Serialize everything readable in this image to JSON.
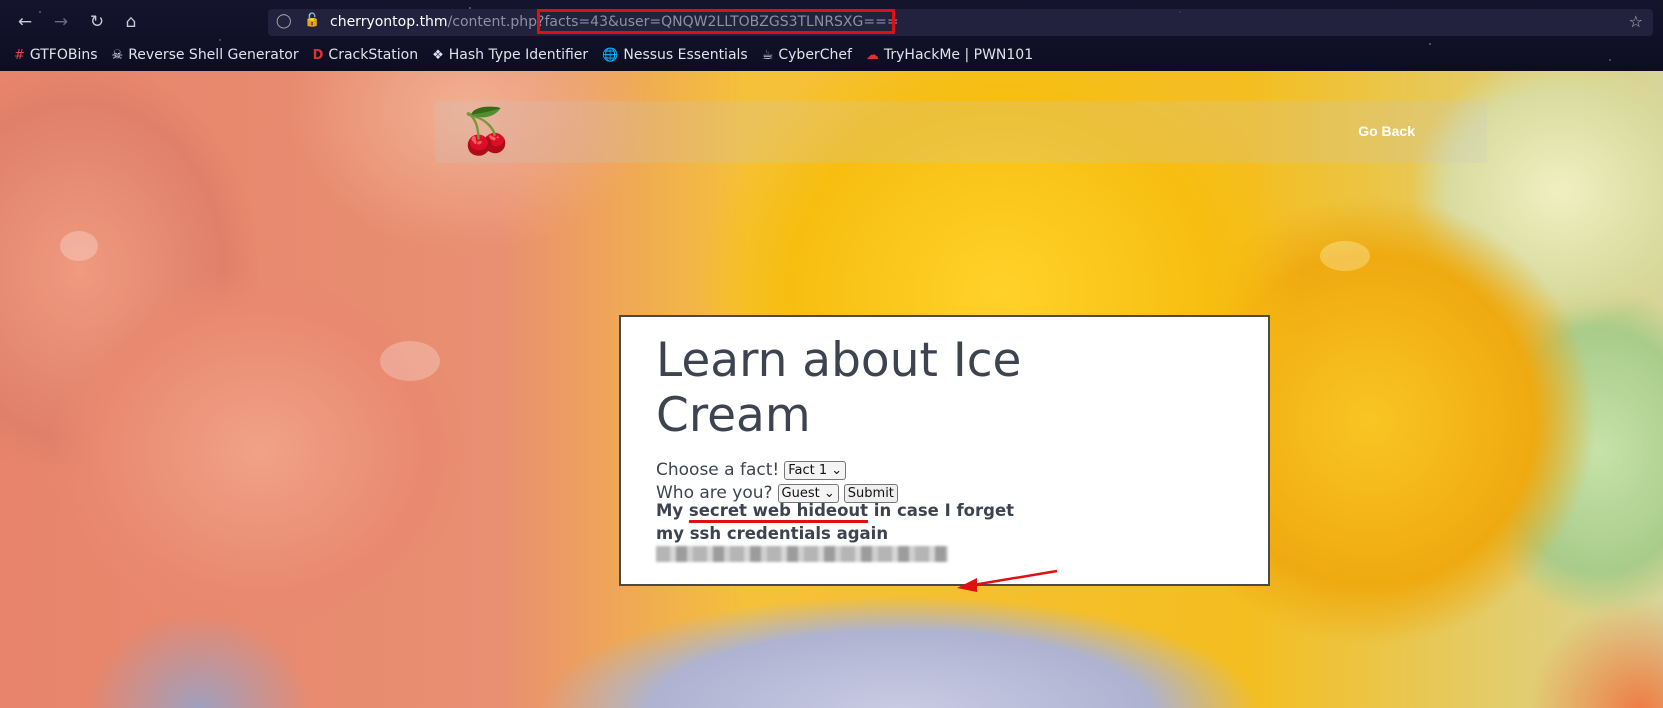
{
  "browser": {
    "url_host": "cherryontop.thm",
    "url_path": "/content.php?",
    "url_query": "facts=43&user=QNQW2LLTOBZGS3TLNRSXG==="
  },
  "bookmarks": [
    {
      "label": "GTFOBins",
      "icon": "hash-icon",
      "color": "#e04040"
    },
    {
      "label": "Reverse Shell Generator",
      "icon": "skull-icon",
      "color": "#dddddd"
    },
    {
      "label": "CrackStation",
      "icon": "d-logo-icon",
      "color": "#e03030"
    },
    {
      "label": "Hash Type Identifier",
      "icon": "hash-identifier-icon",
      "color": "#ffffff"
    },
    {
      "label": "Nessus Essentials",
      "icon": "globe-icon",
      "color": "#cccccc"
    },
    {
      "label": "CyberChef",
      "icon": "chef-hat-icon",
      "color": "#ffffff"
    },
    {
      "label": "TryHackMe | PWN101",
      "icon": "cloud-icon",
      "color": "#e03030"
    }
  ],
  "header": {
    "go_back": "Go Back"
  },
  "card": {
    "title": "Learn about Ice Cream",
    "fact_label": "Choose a fact!",
    "fact_selected": "Fact 1",
    "user_label": "Who are you?",
    "user_selected": "Guest",
    "submit_label": "Submit",
    "message_pre": "My ",
    "message_highlight": "secret web hideout",
    "message_post": " in case I forget my ssh credentials again"
  },
  "annotation_color": "#e01010"
}
